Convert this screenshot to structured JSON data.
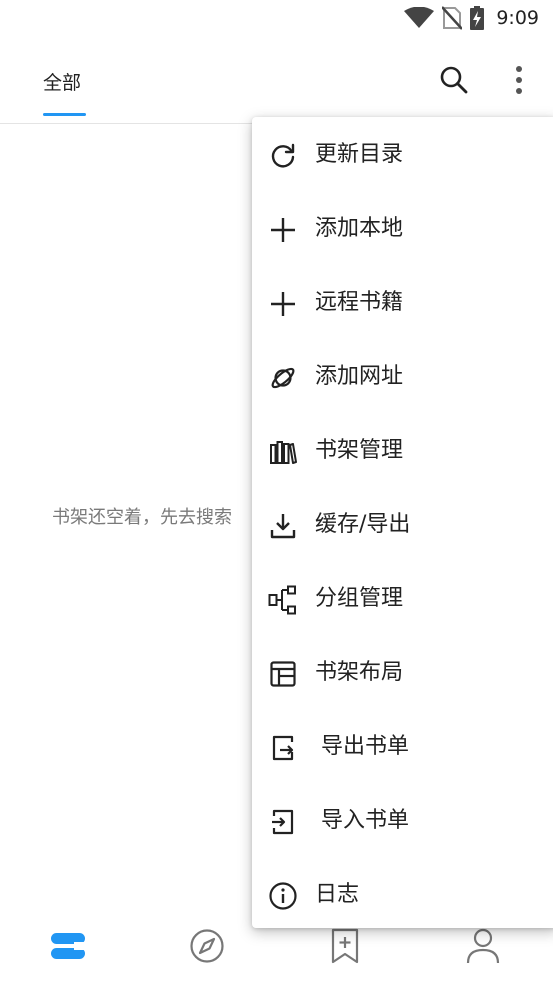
{
  "status_bar": {
    "time": "9:09",
    "icons": [
      "wifi-icon",
      "no-sim-icon",
      "battery-charging-icon"
    ]
  },
  "top_bar": {
    "tab_label": "全部",
    "actions": [
      "search-icon",
      "more-vert-icon"
    ],
    "accent_color": "#2196f3"
  },
  "main": {
    "empty_text": "书架还空着，先去搜索"
  },
  "menu": {
    "items": [
      {
        "label": "更新目录",
        "icon": "refresh-icon"
      },
      {
        "label": "添加本地",
        "icon": "plus-icon"
      },
      {
        "label": "远程书籍",
        "icon": "plus-icon"
      },
      {
        "label": "添加网址",
        "icon": "planet-icon"
      },
      {
        "label": "书架管理",
        "icon": "books-icon"
      },
      {
        "label": "缓存/导出",
        "icon": "download-icon"
      },
      {
        "label": "分组管理",
        "icon": "group-icon"
      },
      {
        "label": "书架布局",
        "icon": "layout-icon"
      },
      {
        "label": "导出书单",
        "icon": "export-icon"
      },
      {
        "label": "导入书单",
        "icon": "import-icon"
      },
      {
        "label": "日志",
        "icon": "info-icon"
      }
    ]
  },
  "bottom_nav": {
    "items": [
      "bookshelf-icon",
      "compass-icon",
      "bookmark-add-icon",
      "person-icon"
    ],
    "active_color": "#2196f3"
  }
}
